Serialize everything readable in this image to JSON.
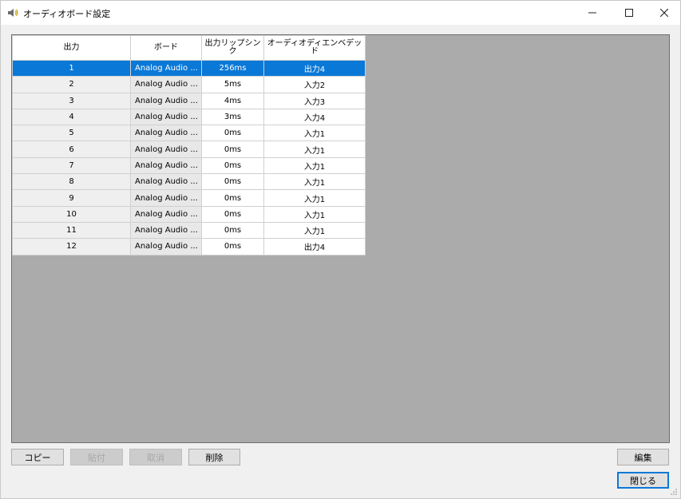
{
  "window": {
    "title": "オーディオボード設定"
  },
  "grid": {
    "columns": [
      "出力",
      "ボード",
      "出力リップシンク",
      "オーディオディエンベデッド"
    ],
    "selected_row": 0,
    "rows": [
      {
        "output": "1",
        "board": "Analog Audio ...",
        "lipsync": "256ms",
        "embed": "出力4"
      },
      {
        "output": "2",
        "board": "Analog Audio ...",
        "lipsync": "5ms",
        "embed": "入力2"
      },
      {
        "output": "3",
        "board": "Analog Audio ...",
        "lipsync": "4ms",
        "embed": "入力3"
      },
      {
        "output": "4",
        "board": "Analog Audio ...",
        "lipsync": "3ms",
        "embed": "入力4"
      },
      {
        "output": "5",
        "board": "Analog Audio ...",
        "lipsync": "0ms",
        "embed": "入力1"
      },
      {
        "output": "6",
        "board": "Analog Audio ...",
        "lipsync": "0ms",
        "embed": "入力1"
      },
      {
        "output": "7",
        "board": "Analog Audio ...",
        "lipsync": "0ms",
        "embed": "入力1"
      },
      {
        "output": "8",
        "board": "Analog Audio ...",
        "lipsync": "0ms",
        "embed": "入力1"
      },
      {
        "output": "9",
        "board": "Analog Audio ...",
        "lipsync": "0ms",
        "embed": "入力1"
      },
      {
        "output": "10",
        "board": "Analog Audio ...",
        "lipsync": "0ms",
        "embed": "入力1"
      },
      {
        "output": "11",
        "board": "Analog Audio ...",
        "lipsync": "0ms",
        "embed": "入力1"
      },
      {
        "output": "12",
        "board": "Analog Audio ...",
        "lipsync": "0ms",
        "embed": "出力4"
      }
    ]
  },
  "buttons": {
    "copy": "コピー",
    "paste": "貼付",
    "cancel": "取消",
    "delete": "削除",
    "edit": "編集",
    "close": "閉じる"
  },
  "icons": {
    "app": "speaker-icon",
    "minimize": "minimize-icon",
    "maximize": "maximize-icon",
    "close": "close-icon",
    "resize": "resize-grip-icon"
  },
  "colors": {
    "selection": "#0a78d7",
    "grid_background": "#ababab",
    "window_background": "#f0f0f0"
  }
}
